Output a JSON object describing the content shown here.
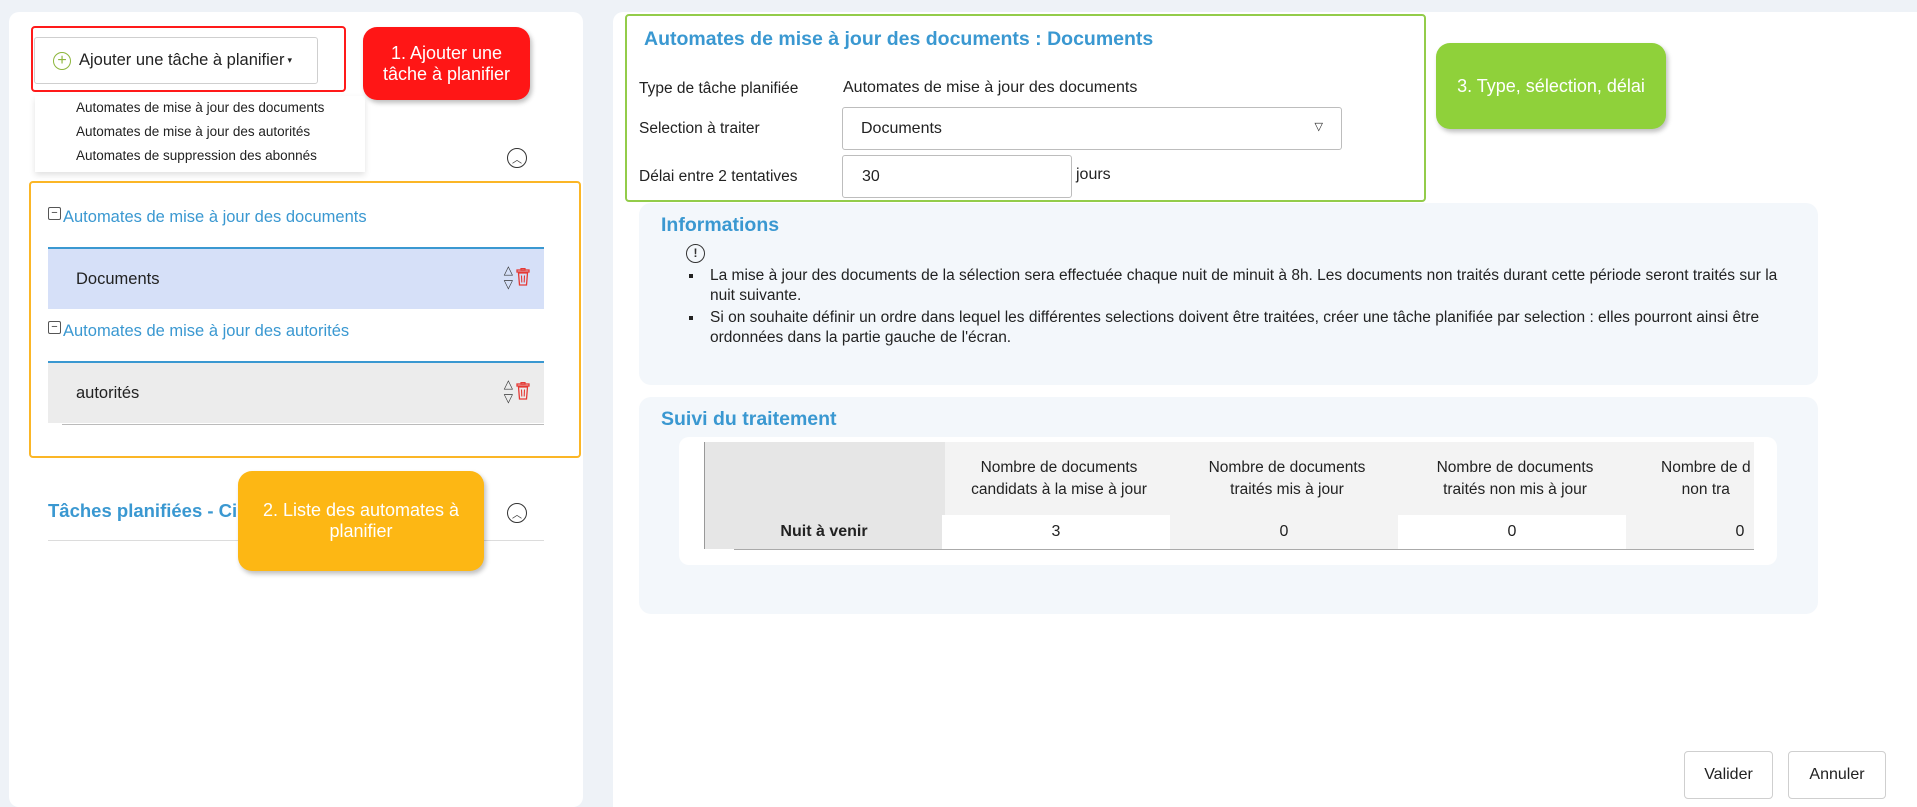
{
  "left": {
    "add_button_label": "Ajouter une tâche à planifier",
    "dropdown_items": [
      "Automates de mise à jour des documents",
      "Automates de mise à jour des autorités",
      "Automates de suppression des abonnés"
    ],
    "groups": [
      {
        "title": "Automates de mise à jour des documents",
        "task": "Documents"
      },
      {
        "title": "Automates de mise à jour des autorités",
        "task": "autorités"
      }
    ],
    "planned_tasks_title": "Tâches planifiées - Cir"
  },
  "callouts": {
    "c1": "1. Ajouter une tâche à planifier",
    "c2": "2. Liste des automates à planifier",
    "c3": "3. Type, sélection, délai"
  },
  "form": {
    "title": "Automates de mise à jour des documents : Documents",
    "type_label": "Type de tâche planifiée",
    "type_value": "Automates de mise à jour des documents",
    "selection_label": "Selection à traiter",
    "selection_value": "Documents",
    "delay_label": "Délai entre 2 tentatives",
    "delay_value": "30",
    "delay_unit": "jours"
  },
  "informations": {
    "title": "Informations",
    "bullets": [
      "La mise à jour des documents de la sélection sera effectuée chaque nuit de minuit à 8h. Les documents non traités durant cette période seront traités sur la nuit suivante.",
      "Si on souhaite définir un ordre dans lequel les différentes selections doivent être traitées, créer une tâche planifiée par selection : elles pourront ainsi être ordonnées dans la partie gauche de l'écran."
    ]
  },
  "suivi": {
    "title": "Suivi du traitement",
    "headers": [
      "Nombre de documents\ncandidats à la mise à jour",
      "Nombre de documents\ntraités mis à jour",
      "Nombre de documents\ntraités non mis à jour",
      "Nombre de d\nnon tra"
    ],
    "row_label": "Nuit à venir",
    "row_values": [
      "3",
      "0",
      "0",
      "0"
    ]
  },
  "buttons": {
    "validate": "Valider",
    "cancel": "Annuler"
  },
  "colors": {
    "accent": "#3a98d1",
    "callout_red": "#ff1616",
    "callout_orange": "#fdb714",
    "callout_green": "#8fd13a",
    "selected_row": "#d6e0f8"
  }
}
